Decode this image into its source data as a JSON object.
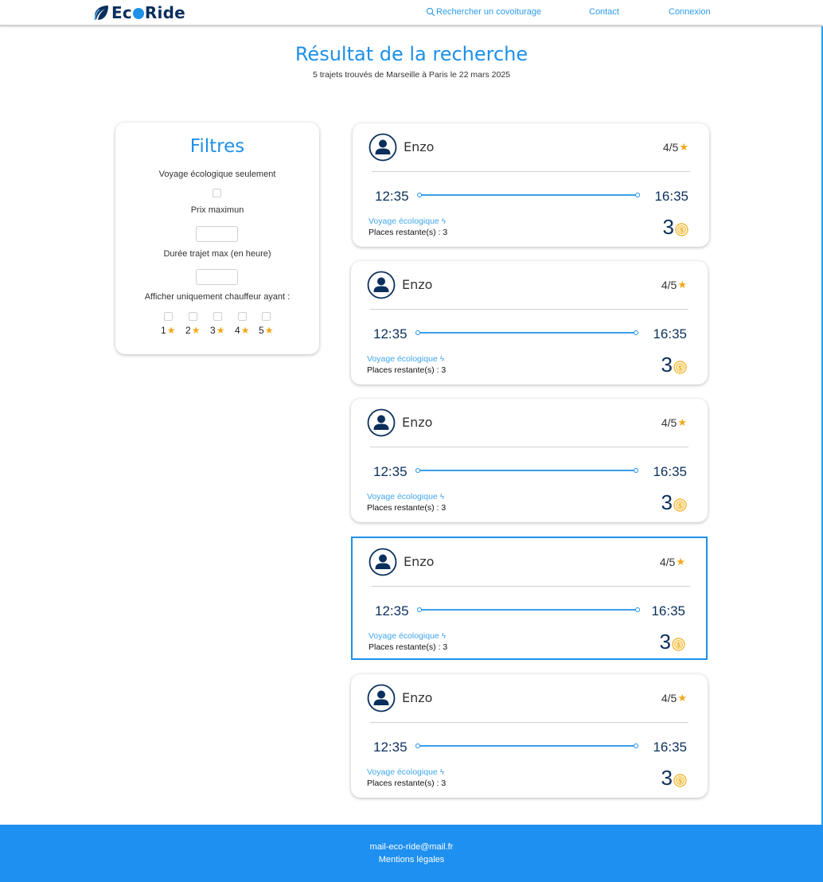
{
  "header": {
    "brand_prefix": "Ec",
    "brand_suffix": "Ride",
    "nav": {
      "search": "Rechercher un covoiturage",
      "contact": "Contact",
      "login": "Connexion"
    }
  },
  "page": {
    "title": "Résultat de la recherche",
    "subtitle": "5 trajets trouvés de Marseille à Paris le 22 mars 2025"
  },
  "filters": {
    "title": "Filtres",
    "eco_only_label": "Voyage écologique seulement",
    "max_price_label": "Prix maximun",
    "max_duration_label": "Durée trajet max (en heure)",
    "driver_rating_label": "Afficher uniquement chauffeur ayant :",
    "rating_options": [
      "1",
      "2",
      "3",
      "4",
      "5"
    ]
  },
  "results": [
    {
      "driver": "Enzo",
      "rating": "4/5",
      "departure": "12:35",
      "arrival": "16:35",
      "eco_label": "Voyage écologique",
      "seats": "Places restante(s) : 3",
      "price": "3",
      "selected": false
    },
    {
      "driver": "Enzo",
      "rating": "4/5",
      "departure": "12:35",
      "arrival": "16:35",
      "eco_label": "Voyage écologique",
      "seats": "Places restante(s) : 3",
      "price": "3",
      "selected": false
    },
    {
      "driver": "Enzo",
      "rating": "4/5",
      "departure": "12:35",
      "arrival": "16:35",
      "eco_label": "Voyage écologique",
      "seats": "Places restante(s) : 3",
      "price": "3",
      "selected": false
    },
    {
      "driver": "Enzo",
      "rating": "4/5",
      "departure": "12:35",
      "arrival": "16:35",
      "eco_label": "Voyage écologique",
      "seats": "Places restante(s) : 3",
      "price": "3",
      "selected": true
    },
    {
      "driver": "Enzo",
      "rating": "4/5",
      "departure": "12:35",
      "arrival": "16:35",
      "eco_label": "Voyage écologique",
      "seats": "Places restante(s) : 3",
      "price": "3",
      "selected": false
    }
  ],
  "footer": {
    "email": "mail-eco-ride@mail.fr",
    "legal": "Mentions légales"
  },
  "colors": {
    "accent": "#1e90e8",
    "navy": "#0a2f5c",
    "star": "#f2a818",
    "coin": "#f4b632"
  },
  "icons": {
    "search": "search-icon",
    "leaf": "leaf-icon",
    "avatar": "user-avatar-icon",
    "star": "star-icon",
    "bolt": "lightning-icon",
    "coin": "coin-icon"
  }
}
